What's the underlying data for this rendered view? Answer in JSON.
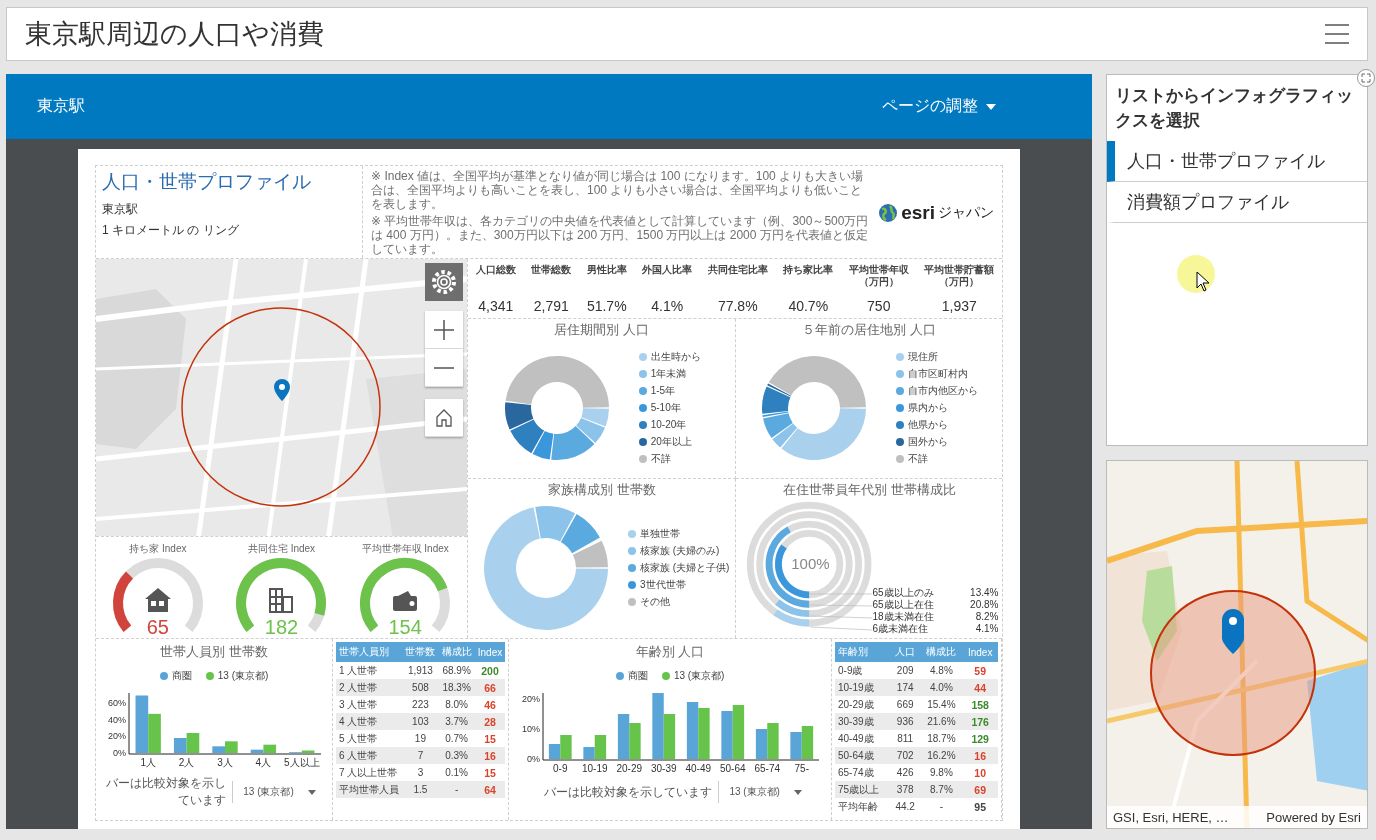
{
  "header": {
    "title": "東京駅周辺の人口や消費"
  },
  "main": {
    "location": "東京駅",
    "page_adjust": "ページの調整",
    "report": {
      "title": "人口・世帯プロファイル",
      "place": "東京駅",
      "ring": "1 キロメートル の リング",
      "notes": [
        "※ Index 値は、全国平均が基準となり値が同じ場合は 100 になります。100 よりも大きい場合は、全国平均よりも高いことを表し、100 よりも小さい場合は、全国平均よりも低いことを表します。",
        "※ 平均世帯年収は、各カテゴリの中央値を代表値として計算しています（例、300～500万円は 400 万円）。また、300万円以下は 200 万円、1500 万円以上は 2000 万円を代表値と仮定しています。"
      ],
      "logo": {
        "mark": "esri",
        "text": "ジャパン"
      },
      "stats": [
        {
          "label": "人口総数",
          "value": "4,341"
        },
        {
          "label": "世帯総数",
          "value": "2,791"
        },
        {
          "label": "男性比率",
          "value": "51.7%"
        },
        {
          "label": "外国人比率",
          "value": "4.1%"
        },
        {
          "label": "共同住宅比率",
          "value": "77.8%"
        },
        {
          "label": "持ち家比率",
          "value": "40.7%"
        },
        {
          "label": "平均世帯年収",
          "unit": "（万円）",
          "value": "750"
        },
        {
          "label": "平均世帯貯蓄額",
          "unit": "（万円）",
          "value": "1,937"
        }
      ],
      "gauges": [
        {
          "label": "持ち家 Index",
          "value": "65",
          "color": "#d0443c"
        },
        {
          "label": "共同住宅 Index",
          "value": "182",
          "color": "#6cc24a"
        },
        {
          "label": "平均世帯年収 Index",
          "value": "154",
          "color": "#6cc24a"
        }
      ],
      "donuts": [
        {
          "title": "居住期間別 人口",
          "legend": [
            {
              "label": "出生時から",
              "color": "#a9d1ee"
            },
            {
              "label": "1年未満",
              "color": "#8cc3ea"
            },
            {
              "label": "1-5年",
              "color": "#5aaae0"
            },
            {
              "label": "5-10年",
              "color": "#3b97dc"
            },
            {
              "label": "10-20年",
              "color": "#2e80bf"
            },
            {
              "label": "20年以上",
              "color": "#2a679e"
            },
            {
              "label": "不詳",
              "color": "#c0c0c0"
            }
          ]
        },
        {
          "title": "５年前の居住地別 人口",
          "legend": [
            {
              "label": "現住所",
              "color": "#a9d1ee"
            },
            {
              "label": "自市区町村内",
              "color": "#8cc3ea"
            },
            {
              "label": "自市内他区から",
              "color": "#5aaae0"
            },
            {
              "label": "県内から",
              "color": "#3b97dc"
            },
            {
              "label": "他県から",
              "color": "#2e80bf"
            },
            {
              "label": "国外から",
              "color": "#2a679e"
            },
            {
              "label": "不詳",
              "color": "#c0c0c0"
            }
          ]
        },
        {
          "title": "家族構成別 世帯数",
          "legend": [
            {
              "label": "単独世帯",
              "color": "#a9d1ee"
            },
            {
              "label": "核家族 (夫婦のみ)",
              "color": "#8cc3ea"
            },
            {
              "label": "核家族 (夫婦と子供)",
              "color": "#5aaae0"
            },
            {
              "label": "3世代世帯",
              "color": "#3b97dc"
            },
            {
              "label": "その他",
              "color": "#c0c0c0"
            }
          ]
        }
      ],
      "ring_chart": {
        "title": "在住世帯員年代別 世帯構成比",
        "center": "100%",
        "legend": [
          {
            "label": "65歳以上のみ",
            "value": "13.4%"
          },
          {
            "label": "65歳以上在住",
            "value": "20.8%"
          },
          {
            "label": "18歳未満在住",
            "value": "8.2%"
          },
          {
            "label": "6歳未満在住",
            "value": "4.1%"
          }
        ]
      },
      "household_chart": {
        "title": "世帯人員別 世帯数",
        "compare_label": "バーは比較対象を示しています",
        "compare_value": "13 (東京都)",
        "chart_data": {
          "type": "bar",
          "categories": [
            "1人",
            "2人",
            "3人",
            "4人",
            "5人以上"
          ],
          "series": [
            {
              "name": "商圏",
              "color": "#5aa5d8",
              "values": [
                69,
                18,
                8,
                4,
                1
              ]
            },
            {
              "name": "13 (東京都)",
              "color": "#66c44b",
              "values": [
                47,
                24,
                14,
                10,
                3
              ]
            }
          ],
          "ylim": [
            0,
            72
          ],
          "yticks": [
            {
              "value": 0,
              "label": "0%"
            },
            {
              "value": 20,
              "label": "20%"
            },
            {
              "value": 40,
              "label": "40%"
            },
            {
              "value": 60,
              "label": "60%"
            }
          ]
        }
      },
      "household_table": {
        "columns": [
          "世帯人員別",
          "世帯数",
          "構成比",
          "Index"
        ],
        "rows": [
          {
            "cells": [
              "1 人世帯",
              "1,913",
              "68.9%",
              "200"
            ],
            "color": "#3d8a2a"
          },
          {
            "cells": [
              "2 人世帯",
              "508",
              "18.3%",
              "66"
            ],
            "color": "#d9432b"
          },
          {
            "cells": [
              "3 人世帯",
              "223",
              "8.0%",
              "46"
            ],
            "color": "#d9432b"
          },
          {
            "cells": [
              "4 人世帯",
              "103",
              "3.7%",
              "28"
            ],
            "color": "#d9432b"
          },
          {
            "cells": [
              "5 人世帯",
              "19",
              "0.7%",
              "15"
            ],
            "color": "#d9432b"
          },
          {
            "cells": [
              "6 人世帯",
              "7",
              "0.3%",
              "16"
            ],
            "color": "#d9432b"
          },
          {
            "cells": [
              "7 人以上世帯",
              "3",
              "0.1%",
              "15"
            ],
            "color": "#d9432b"
          },
          {
            "cells": [
              "平均世帯人員",
              "1.5",
              "-",
              "64"
            ],
            "color": "#d9432b"
          }
        ]
      },
      "age_chart": {
        "title": "年齢別 人口",
        "compare_label": "バーは比較対象を示しています",
        "compare_value": "13 (東京都)",
        "chart_data": {
          "type": "bar",
          "categories": [
            "0-9",
            "10-19",
            "20-29",
            "30-39",
            "40-49",
            "50-64",
            "65-74",
            "75-"
          ],
          "series": [
            {
              "name": "商圏",
              "color": "#5aa5d8",
              "values": [
                5,
                4,
                15,
                22,
                19,
                16,
                10,
                9
              ]
            },
            {
              "name": "13 (東京都)",
              "color": "#66c44b",
              "values": [
                8,
                8,
                12,
                15,
                17,
                18,
                12,
                11
              ]
            }
          ],
          "ylim": [
            0,
            22
          ],
          "yticks": [
            {
              "value": 0,
              "label": "0%"
            },
            {
              "value": 10,
              "label": "10%"
            },
            {
              "value": 20,
              "label": "20%"
            }
          ]
        }
      },
      "age_table": {
        "columns": [
          "年齢別",
          "人口",
          "構成比",
          "Index"
        ],
        "rows": [
          {
            "cells": [
              "0-9歳",
              "209",
              "4.8%",
              "59"
            ],
            "color": "#d9432b"
          },
          {
            "cells": [
              "10-19歳",
              "174",
              "4.0%",
              "44"
            ],
            "color": "#d9432b"
          },
          {
            "cells": [
              "20-29歳",
              "669",
              "15.4%",
              "158"
            ],
            "color": "#3d8a2a"
          },
          {
            "cells": [
              "30-39歳",
              "936",
              "21.6%",
              "176"
            ],
            "color": "#3d8a2a"
          },
          {
            "cells": [
              "40-49歳",
              "811",
              "18.7%",
              "129"
            ],
            "color": "#3d8a2a"
          },
          {
            "cells": [
              "50-64歳",
              "702",
              "16.2%",
              "16"
            ],
            "color": "#d9432b"
          },
          {
            "cells": [
              "65-74歳",
              "426",
              "9.8%",
              "10"
            ],
            "color": "#d9432b"
          },
          {
            "cells": [
              "75歳以上",
              "378",
              "8.7%",
              "69"
            ],
            "color": "#d9432b"
          },
          {
            "cells": [
              "平均年齢",
              "44.2",
              "-",
              "95"
            ],
            "color": "#444444"
          }
        ]
      }
    }
  },
  "side": {
    "list_title": "リストからインフォグラフィックスを選択",
    "items": [
      {
        "label": "人口・世帯プロファイル",
        "selected": true
      },
      {
        "label": "消費額プロファイル",
        "selected": false
      }
    ],
    "map": {
      "attribution": "GSI, Esri, HERE, …",
      "powered": "Powered by Esri"
    }
  }
}
